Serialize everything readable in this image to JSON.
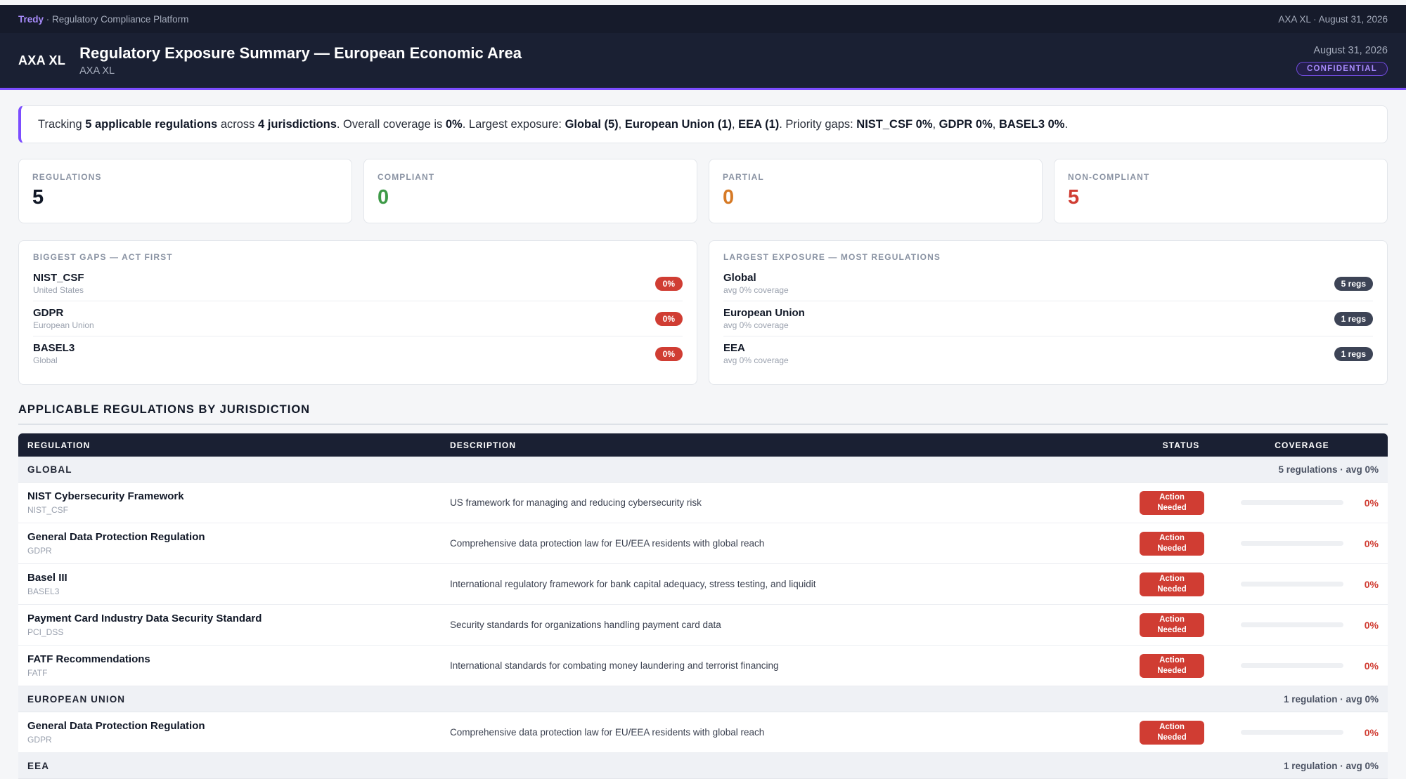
{
  "topbar": {
    "brand": "Tredy",
    "platform": "Regulatory Compliance Platform",
    "org_date": "AXA XL · August 31, 2026"
  },
  "header": {
    "logo": "AXA XL",
    "title": "Regulatory Exposure Summary — European Economic Area",
    "subtitle": "AXA XL",
    "date": "August 31, 2026",
    "badge": "CONFIDENTIAL"
  },
  "summary": {
    "t1": "Tracking ",
    "b1": "5 applicable regulations",
    "t2": " across ",
    "b2": "4 jurisdictions",
    "t3": ". Overall coverage is ",
    "b3": "0%",
    "t4": ". Largest exposure: ",
    "b4": "Global (5)",
    "t5": ", ",
    "b5": "European Union (1)",
    "t6": ", ",
    "b6": "EEA (1)",
    "t7": ". Priority gaps: ",
    "b7": "NIST_CSF 0%",
    "t8": ", ",
    "b8": "GDPR 0%",
    "t9": ", ",
    "b9": "BASEL3 0%",
    "t10": "."
  },
  "cards": [
    {
      "label": "REGULATIONS",
      "value": "5"
    },
    {
      "label": "COMPLIANT",
      "value": "0"
    },
    {
      "label": "PARTIAL",
      "value": "0"
    },
    {
      "label": "NON-COMPLIANT",
      "value": "5"
    }
  ],
  "gaps": {
    "title": "BIGGEST GAPS — ACT FIRST",
    "items": [
      {
        "name": "NIST_CSF",
        "sub": "United States",
        "pill": "0%"
      },
      {
        "name": "GDPR",
        "sub": "European Union",
        "pill": "0%"
      },
      {
        "name": "BASEL3",
        "sub": "Global",
        "pill": "0%"
      }
    ]
  },
  "exposure": {
    "title": "LARGEST EXPOSURE — MOST REGULATIONS",
    "items": [
      {
        "name": "Global",
        "sub": "avg 0% coverage",
        "pill": "5 regs"
      },
      {
        "name": "European Union",
        "sub": "avg 0% coverage",
        "pill": "1 regs"
      },
      {
        "name": "EEA",
        "sub": "avg 0% coverage",
        "pill": "1 regs"
      }
    ]
  },
  "section": {
    "title": "APPLICABLE REGULATIONS BY JURISDICTION"
  },
  "table": {
    "headers": {
      "regulation": "REGULATION",
      "description": "DESCRIPTION",
      "status": "STATUS",
      "coverage": "COVERAGE"
    },
    "groups": [
      {
        "name": "GLOBAL",
        "summary": "5 regulations · avg 0%",
        "rows": [
          {
            "name": "NIST Cybersecurity Framework",
            "code": "NIST_CSF",
            "desc": "US framework for managing and reducing cybersecurity risk",
            "status1": "Action",
            "status2": "Needed",
            "pct": "0%",
            "coverage": 0
          },
          {
            "name": "General Data Protection Regulation",
            "code": "GDPR",
            "desc": "Comprehensive data protection law for EU/EEA residents with global reach",
            "status1": "Action",
            "status2": "Needed",
            "pct": "0%",
            "coverage": 0
          },
          {
            "name": "Basel III",
            "code": "BASEL3",
            "desc": "International regulatory framework for bank capital adequacy, stress testing, and liquidit",
            "status1": "Action",
            "status2": "Needed",
            "pct": "0%",
            "coverage": 0
          },
          {
            "name": "Payment Card Industry Data Security Standard",
            "code": "PCI_DSS",
            "desc": "Security standards for organizations handling payment card data",
            "status1": "Action",
            "status2": "Needed",
            "pct": "0%",
            "coverage": 0
          },
          {
            "name": "FATF Recommendations",
            "code": "FATF",
            "desc": "International standards for combating money laundering and terrorist financing",
            "status1": "Action",
            "status2": "Needed",
            "pct": "0%",
            "coverage": 0
          }
        ]
      },
      {
        "name": "EUROPEAN UNION",
        "summary": "1 regulation · avg 0%",
        "rows": [
          {
            "name": "General Data Protection Regulation",
            "code": "GDPR",
            "desc": "Comprehensive data protection law for EU/EEA residents with global reach",
            "status1": "Action",
            "status2": "Needed",
            "pct": "0%",
            "coverage": 0
          }
        ]
      },
      {
        "name": "EEA",
        "summary": "1 regulation · avg 0%",
        "rows": []
      }
    ]
  },
  "colors": {
    "accent": "#7c4dff",
    "navy": "#1a2033",
    "red": "#d03d33",
    "green": "#3d9a47",
    "orange": "#d67a26"
  }
}
